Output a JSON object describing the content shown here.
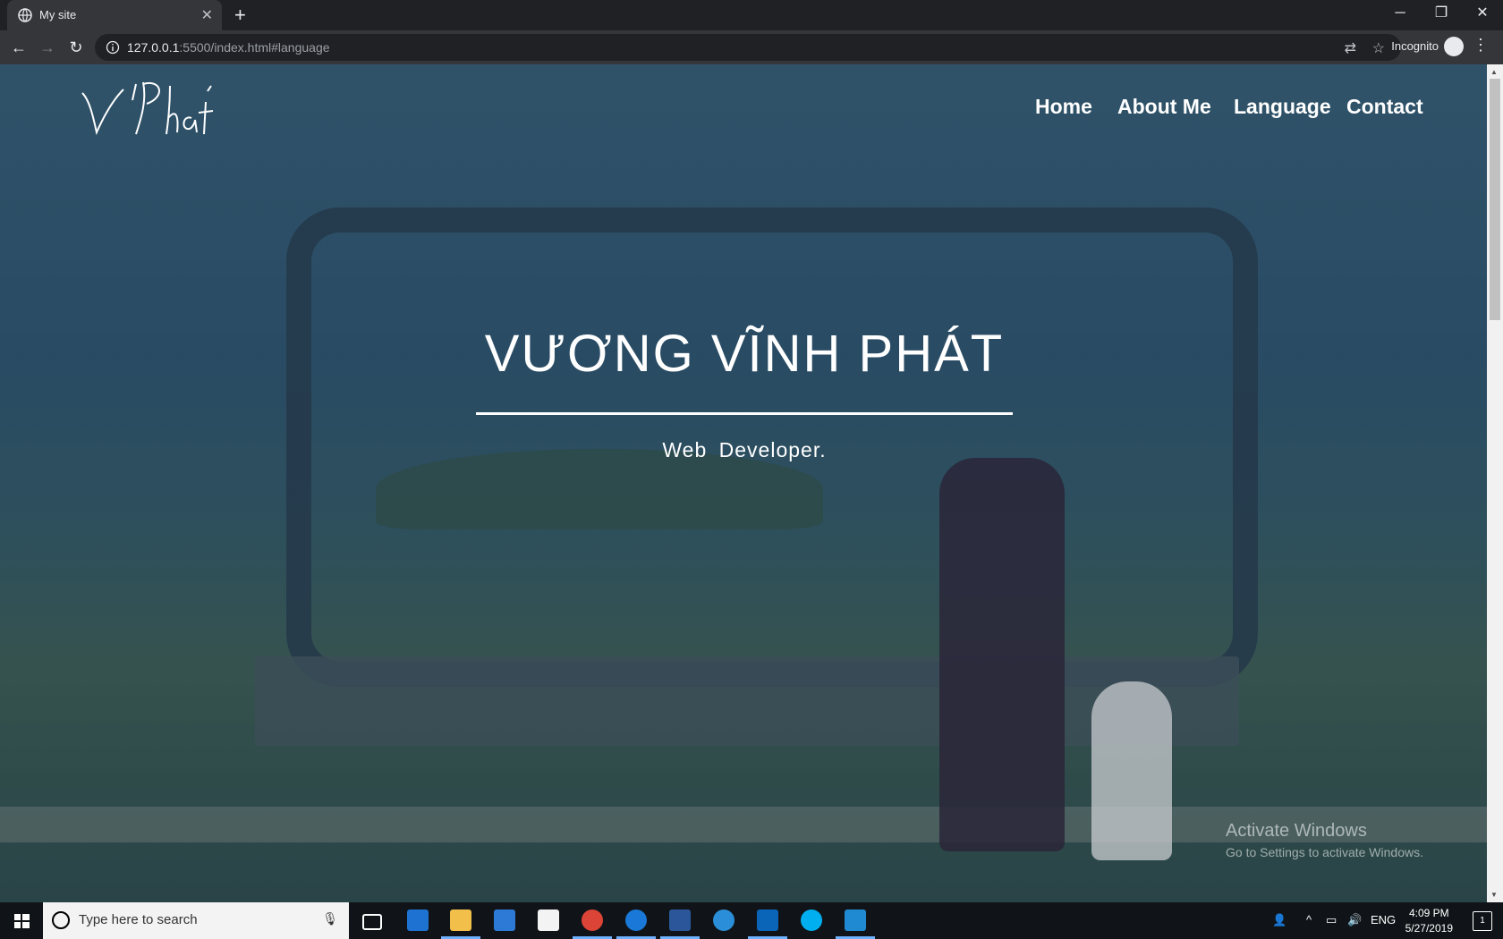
{
  "browser": {
    "tab_title": "My site",
    "tab_close": "✕",
    "new_tab": "+",
    "url_host": "127.0.0.1",
    "url_rest": ":5500/index.html#language",
    "incognito_label": "Incognito",
    "window_controls": [
      "─",
      "❐",
      "✕"
    ]
  },
  "site": {
    "logo_text": "V Phát",
    "nav": [
      "Home",
      "About Me",
      "Language",
      "Contact"
    ],
    "hero_title": "VƯƠNG VĨNH PHÁT",
    "hero_subtitle": "Web Developer."
  },
  "watermark": {
    "line1": "Activate Windows",
    "line2": "Go to Settings to activate Windows."
  },
  "taskbar": {
    "search_placeholder": "Type here to search",
    "lang": "ENG",
    "time": "4:09 PM",
    "date": "5/27/2019",
    "notifications": "1",
    "apps": [
      "task-view",
      "edge",
      "file-explorer",
      "store",
      "mail",
      "chrome",
      "teamviewer",
      "word",
      "internet-explorer",
      "outlook",
      "skype",
      "vscode"
    ]
  }
}
